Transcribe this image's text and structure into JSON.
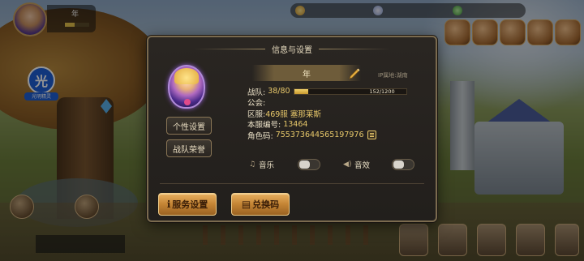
{
  "dialog": {
    "title": "信息与设置",
    "player_name": "年",
    "ip_location": "IP属地:湖南",
    "team_label": "战队:",
    "team_value": "38/80",
    "xp_text": "152/1200",
    "xp_progress": 0.1267,
    "guild_label": "公会:",
    "guild_value": "",
    "server_label": "区服:",
    "server_value": "469服 塞那莱斯",
    "server_no_label": "本服编号:",
    "server_no_value": "13464",
    "role_code_label": "角色码:",
    "role_code_value": "755373644565197976",
    "music_label": "音乐",
    "sound_label": "音效",
    "music_on": false,
    "sound_on": false,
    "btn_personal": "个性设置",
    "btn_honor": "战队荣誉",
    "btn_service": "服务设置",
    "btn_redeem": "兑换码"
  },
  "hud": {
    "top_name": "年",
    "side_badge": "光",
    "side_badge_sub": "光明精灵"
  },
  "colors": {
    "accent_gold": "#e8c86a",
    "button_orange": "#c48434",
    "panel_bg": "#2a2622",
    "panel_border": "#7a6a4e"
  },
  "icons": [
    "edit-icon",
    "copy-icon",
    "music-note-icon",
    "speaker-icon",
    "info-icon",
    "ticket-icon",
    "avatar-portrait"
  ]
}
